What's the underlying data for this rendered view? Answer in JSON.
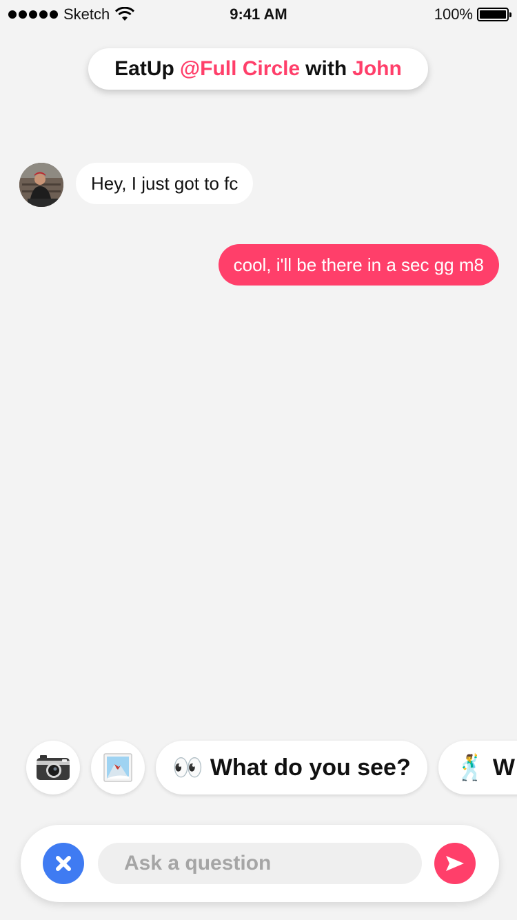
{
  "status_bar": {
    "carrier": "Sketch",
    "time": "9:41 AM",
    "battery": "100%"
  },
  "header": {
    "app": "EatUp",
    "place": "@Full Circle",
    "with": "with",
    "person": "John"
  },
  "messages": [
    {
      "from": "them",
      "text": "Hey, I just got to fc"
    },
    {
      "from": "me",
      "text": "cool, i'll be there in a sec gg m8"
    }
  ],
  "quick_replies": {
    "camera_icon": "camera-icon",
    "photo_icon": "photo-icon",
    "items": [
      {
        "emoji": "👀",
        "label": "What do you see?"
      },
      {
        "emoji": "🕺",
        "label": "W"
      }
    ]
  },
  "input": {
    "placeholder": "Ask a question",
    "value": ""
  },
  "colors": {
    "accent": "#ff3f6a",
    "close_button": "#3f7bf2",
    "background": "#f3f3f3"
  }
}
